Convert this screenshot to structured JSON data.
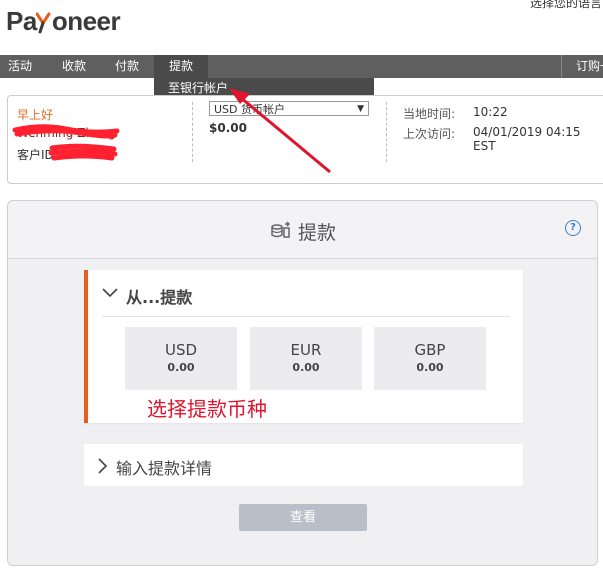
{
  "header": {
    "language_link": "选择您的语言",
    "logo": {
      "text_pa": "Pa",
      "text_rest": "oneer",
      "mark_color": "#e85c1e"
    }
  },
  "nav": {
    "items": [
      {
        "label": "活动"
      },
      {
        "label": "收款"
      },
      {
        "label": "付款"
      },
      {
        "label": "提款"
      }
    ],
    "right_item": "订购一",
    "dropdown_item": "至银行帐户"
  },
  "account": {
    "greeting": "早上好",
    "user_name": "Wenming Zhang",
    "customer_id_label": "客户ID",
    "currency_select_value": "USD 货币帐户",
    "balance": "$0.00",
    "local_time_label": "当地时间:",
    "local_time_value": "10:22",
    "last_visit_label": "上次访问:",
    "last_visit_value": "04/01/2019 04:15 EST"
  },
  "withdraw": {
    "title": "提款",
    "help_symbol": "?",
    "from_section_title": "从...提款",
    "currencies": [
      {
        "code": "USD",
        "amount": "0.00"
      },
      {
        "code": "EUR",
        "amount": "0.00"
      },
      {
        "code": "GBP",
        "amount": "0.00"
      }
    ],
    "annotation": "选择提款币种",
    "details_section_title": "输入提款详情",
    "view_button": "查看"
  },
  "colors": {
    "accent": "#e85c1e",
    "nav_bg": "#5f5f5f",
    "annotation_red": "#e0142d",
    "help_blue": "#3f7fc2"
  }
}
